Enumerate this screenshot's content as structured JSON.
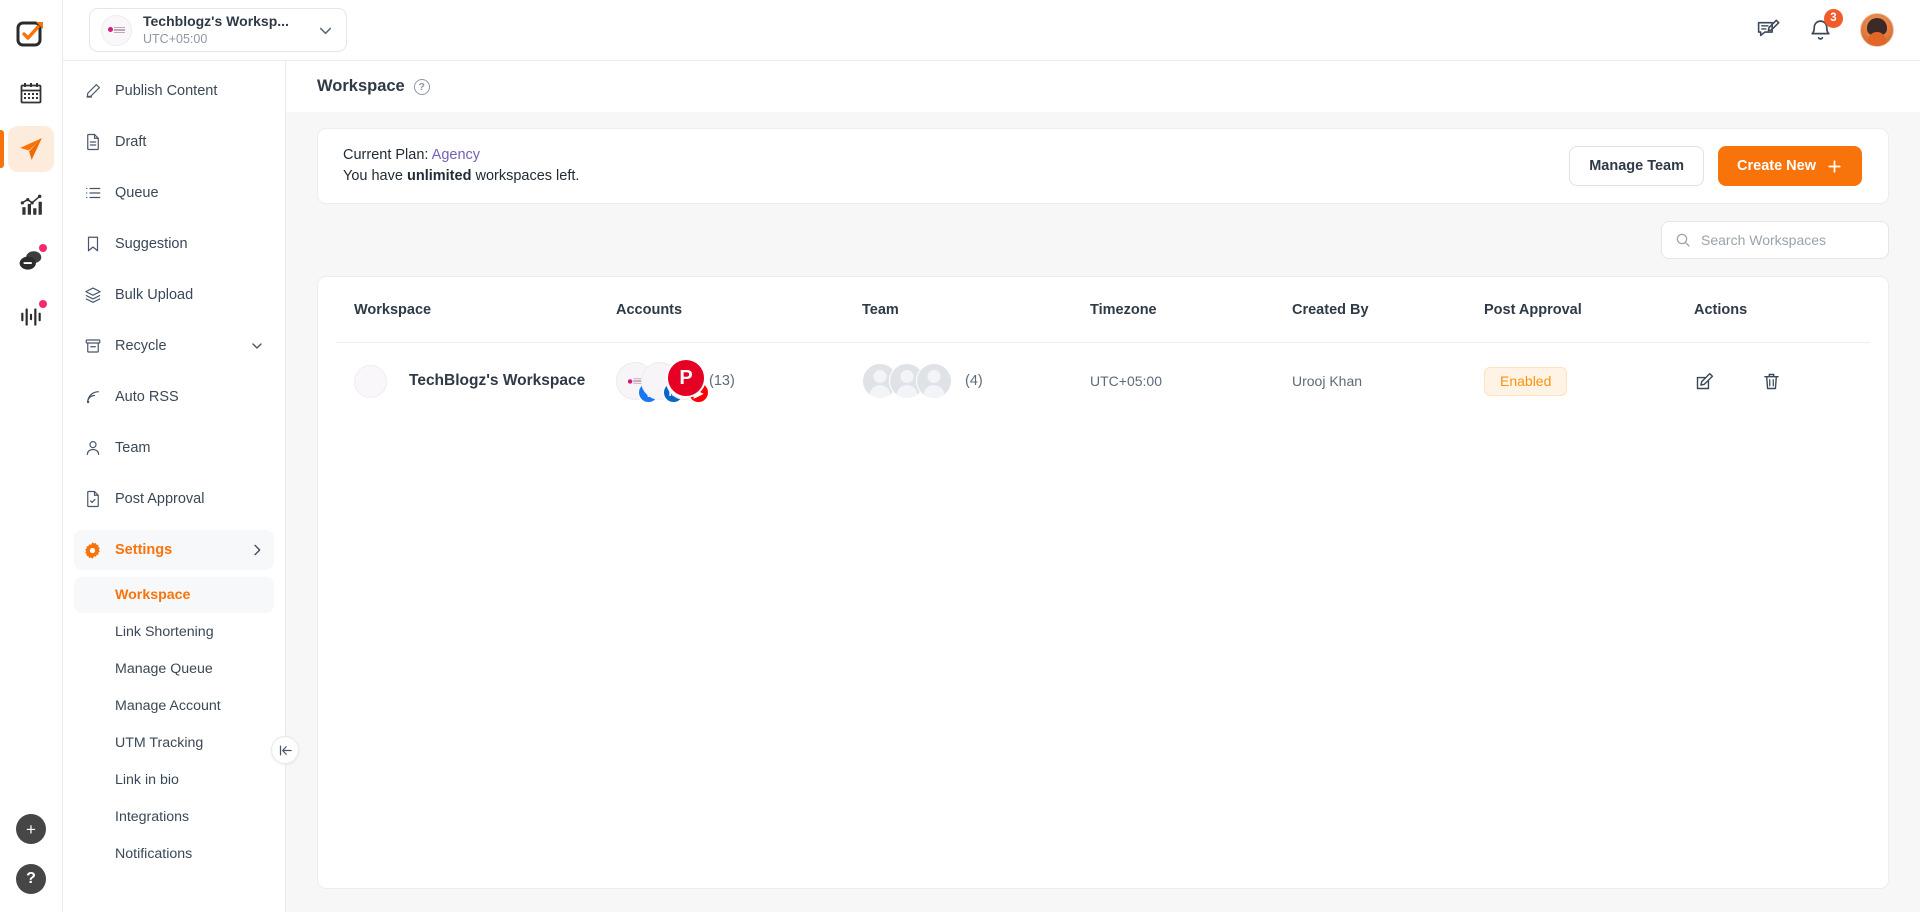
{
  "brand": {
    "accent": "#f8740b",
    "danger": "#f8296b",
    "link": "#7561b5"
  },
  "rail": {
    "logo_name": "contentstudio-logo",
    "items": [
      {
        "name": "calendar-icon",
        "label": "Calendar",
        "active": false,
        "dot": false
      },
      {
        "name": "publish-icon",
        "label": "Publish",
        "active": true,
        "dot": false
      },
      {
        "name": "analytics-icon",
        "label": "Analytics",
        "active": false,
        "dot": false
      },
      {
        "name": "inbox-icon",
        "label": "Inbox",
        "active": false,
        "dot": true
      },
      {
        "name": "influencer-icon",
        "label": "Influencer",
        "active": false,
        "dot": true
      }
    ],
    "bottom": [
      {
        "name": "add-button",
        "glyph": "+"
      },
      {
        "name": "help-button",
        "glyph": "?"
      }
    ]
  },
  "topbar": {
    "workspace_name": "Techblogz's Worksp...",
    "workspace_timezone": "UTC+05:00",
    "chevron": "chevron-down-icon",
    "compose_icon": "compose-icon",
    "notifications_icon": "bell-icon",
    "notifications_count": "3",
    "avatar": "user-avatar"
  },
  "sidebar": {
    "items": [
      {
        "label": "Publish Content",
        "icon": "pencil-icon",
        "active": false,
        "expandable": false
      },
      {
        "label": "Draft",
        "icon": "document-icon",
        "active": false,
        "expandable": false
      },
      {
        "label": "Queue",
        "icon": "list-icon",
        "active": false,
        "expandable": false
      },
      {
        "label": "Suggestion",
        "icon": "bookmark-icon",
        "active": false,
        "expandable": false
      },
      {
        "label": "Bulk Upload",
        "icon": "layers-icon",
        "active": false,
        "expandable": false
      },
      {
        "label": "Recycle",
        "icon": "archive-icon",
        "active": false,
        "expandable": true
      },
      {
        "label": "Auto RSS",
        "icon": "rss-icon",
        "active": false,
        "expandable": false
      },
      {
        "label": "Team",
        "icon": "person-icon",
        "active": false,
        "expandable": false
      },
      {
        "label": "Post Approval",
        "icon": "document-check-icon",
        "active": false,
        "expandable": false
      },
      {
        "label": "Settings",
        "icon": "gear-icon",
        "active": true,
        "expandable": true
      }
    ],
    "sub_items": [
      {
        "label": "Workspace",
        "active": true
      },
      {
        "label": "Link Shortening",
        "active": false
      },
      {
        "label": "Manage Queue",
        "active": false
      },
      {
        "label": "Manage Account",
        "active": false
      },
      {
        "label": "UTM Tracking",
        "active": false
      },
      {
        "label": "Link in bio",
        "active": false
      },
      {
        "label": "Integrations",
        "active": false
      },
      {
        "label": "Notifications",
        "active": false
      }
    ],
    "collapse_icon": "collapse-sidebar-icon"
  },
  "page": {
    "title": "Workspace",
    "help_glyph": "?"
  },
  "plan_banner": {
    "current_plan_prefix": "Current Plan:",
    "plan_name": "Agency",
    "quota_prefix": "You have",
    "quota_value": "unlimited",
    "quota_suffix": "workspaces left.",
    "manage_team_label": "Manage Team",
    "create_new_label": "Create New",
    "create_new_glyph": "+"
  },
  "search": {
    "placeholder": "Search Workspaces",
    "value": "",
    "icon": "search-icon"
  },
  "table": {
    "headers": [
      "Workspace",
      "Accounts",
      "Team",
      "Timezone",
      "Created By",
      "Post Approval",
      "Actions"
    ],
    "rows": [
      {
        "workspace": "TechBlogz's Workspace",
        "accounts_count": "(13)",
        "accounts_platforms": [
          "facebook",
          "linkedin",
          "youtube",
          "pinterest"
        ],
        "team_count": "(4)",
        "team_avatar_count": 3,
        "timezone": "UTC+05:00",
        "created_by": "Urooj Khan",
        "post_approval": "Enabled",
        "actions": [
          "edit-icon",
          "delete-icon"
        ]
      }
    ]
  }
}
